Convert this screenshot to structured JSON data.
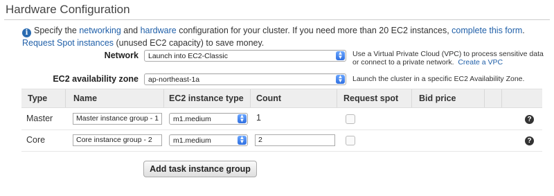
{
  "section": {
    "title": "Hardware Configuration"
  },
  "info": {
    "text_1": "Specify the ",
    "link_networking": "networking",
    "text_2": " and ",
    "link_hardware": "hardware",
    "text_3": " configuration for your cluster. If you need more than 20 EC2 instances, ",
    "link_form": "complete this form",
    "text_4": ".",
    "link_spot": "Request Spot instances",
    "text_5": " (unused EC2 capacity) to save money."
  },
  "network": {
    "label": "Network",
    "value": "Launch into EC2-Classic",
    "hint_1": "Use a Virtual Private Cloud (VPC) to process sensitive data",
    "hint_2": "or connect to a private network.",
    "hint_link": "Create a VPC"
  },
  "zone": {
    "label": "EC2 availability zone",
    "value": "ap-northeast-1a",
    "hint": "Launch the cluster in a specific EC2 Availability Zone."
  },
  "table": {
    "headers": [
      "Type",
      "Name",
      "EC2 instance type",
      "Count",
      "Request spot",
      "Bid price"
    ],
    "rows": [
      {
        "type": "Master",
        "name": "Master instance group - 1",
        "instance_type": "m1.medium",
        "count": "1"
      },
      {
        "type": "Core",
        "name": "Core instance group - 2",
        "instance_type": "m1.medium",
        "count": "2"
      }
    ]
  },
  "buttons": {
    "add_task": "Add task instance group"
  },
  "icons": {
    "info": "info-icon",
    "help": "help-icon",
    "select_arrow": "updown-chevron-icon"
  },
  "colors": {
    "link": "#1f5fa8",
    "select_accent": "#2f6fe0",
    "header_bg": "#eeeeee"
  }
}
